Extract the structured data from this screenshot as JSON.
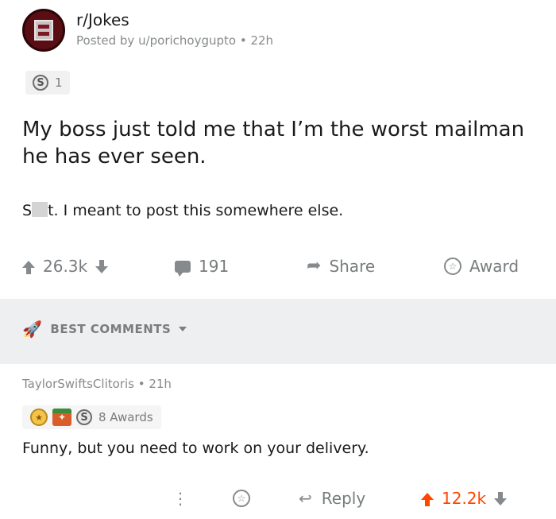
{
  "post": {
    "subreddit": "r/Jokes",
    "posted_by": "Posted by u/porichoygupto • 22h",
    "award_count": "1",
    "title": "My boss just told me that I’m the worst mailman he has ever seen.",
    "body_prefix": "S",
    "body_suffix": "t. I meant to post this somewhere else.",
    "votes": "26.3k",
    "comments": "191",
    "share_label": "Share",
    "award_label": "Award"
  },
  "sort": {
    "label": "BEST COMMENTS"
  },
  "comment": {
    "meta": "TaylorSwiftsClitoris • 21h",
    "awards_label": "8 Awards",
    "body": "Funny, but you need to work on your delivery.",
    "more_label": "⋮",
    "reply_label": "Reply",
    "votes": "12.2k"
  },
  "icons": {
    "upvote": "upvote-icon",
    "downvote": "downvote-icon",
    "comment": "comment-icon",
    "share": "share-icon",
    "award": "award-icon",
    "rocket": "rocket-icon",
    "reply": "reply-icon",
    "silver": "silver-award-icon"
  },
  "colors": {
    "upvoted": "#ff4500",
    "muted": "#878a8c",
    "band": "#edeff1"
  }
}
